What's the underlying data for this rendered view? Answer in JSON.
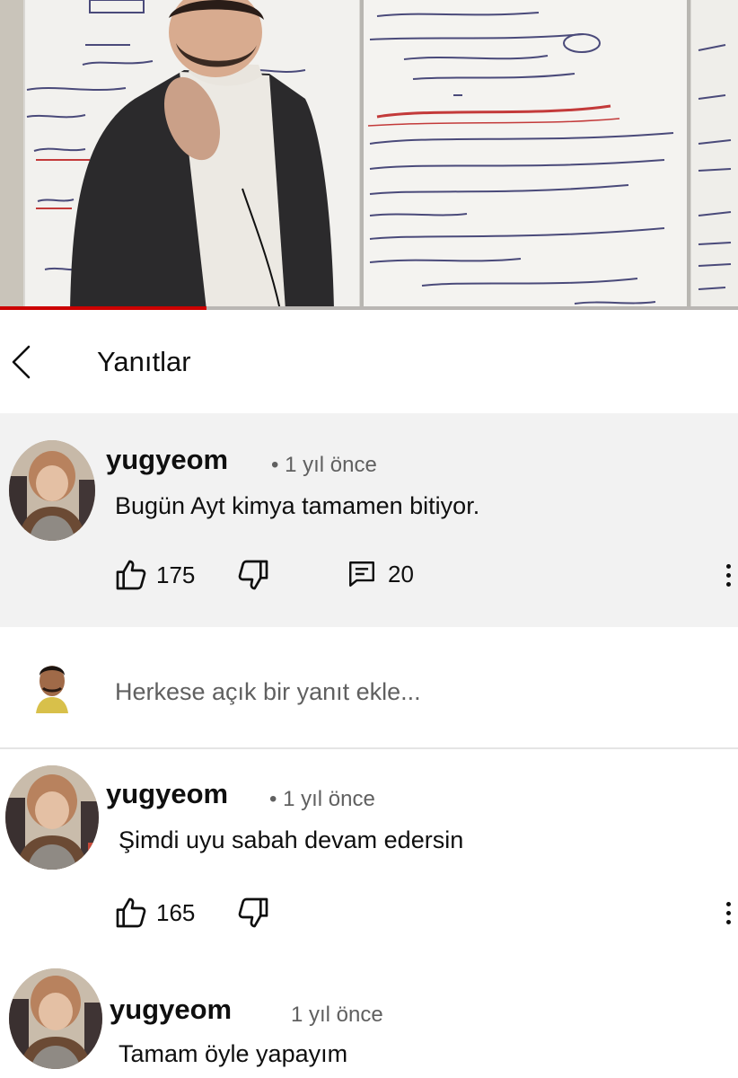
{
  "video": {
    "progress_fraction": 0.28
  },
  "header": {
    "title": "Yanıtlar"
  },
  "top_comment": {
    "author": "yugyeom",
    "time": "• 1 yıl önce",
    "text": "Bugün Ayt kimya tamamen bitiyor.",
    "likes": "175",
    "replies": "20"
  },
  "reply_box": {
    "placeholder": "Herkese açık bir yanıt ekle..."
  },
  "replies": [
    {
      "author": "yugyeom",
      "time": "• 1 yıl önce",
      "text": "Şimdi uyu sabah devam edersin",
      "likes": "165"
    },
    {
      "author": "yugyeom",
      "time": "1 yıl önce",
      "text": "Tamam öyle yapayım"
    }
  ],
  "icons": [
    "back-arrow-icon",
    "thumbs-up-icon",
    "thumbs-down-icon",
    "comment-icon",
    "more-vert-icon"
  ],
  "colors": {
    "progress": "#cc0000",
    "highlight_bg": "#f2f2f2",
    "secondary_text": "#606060"
  }
}
